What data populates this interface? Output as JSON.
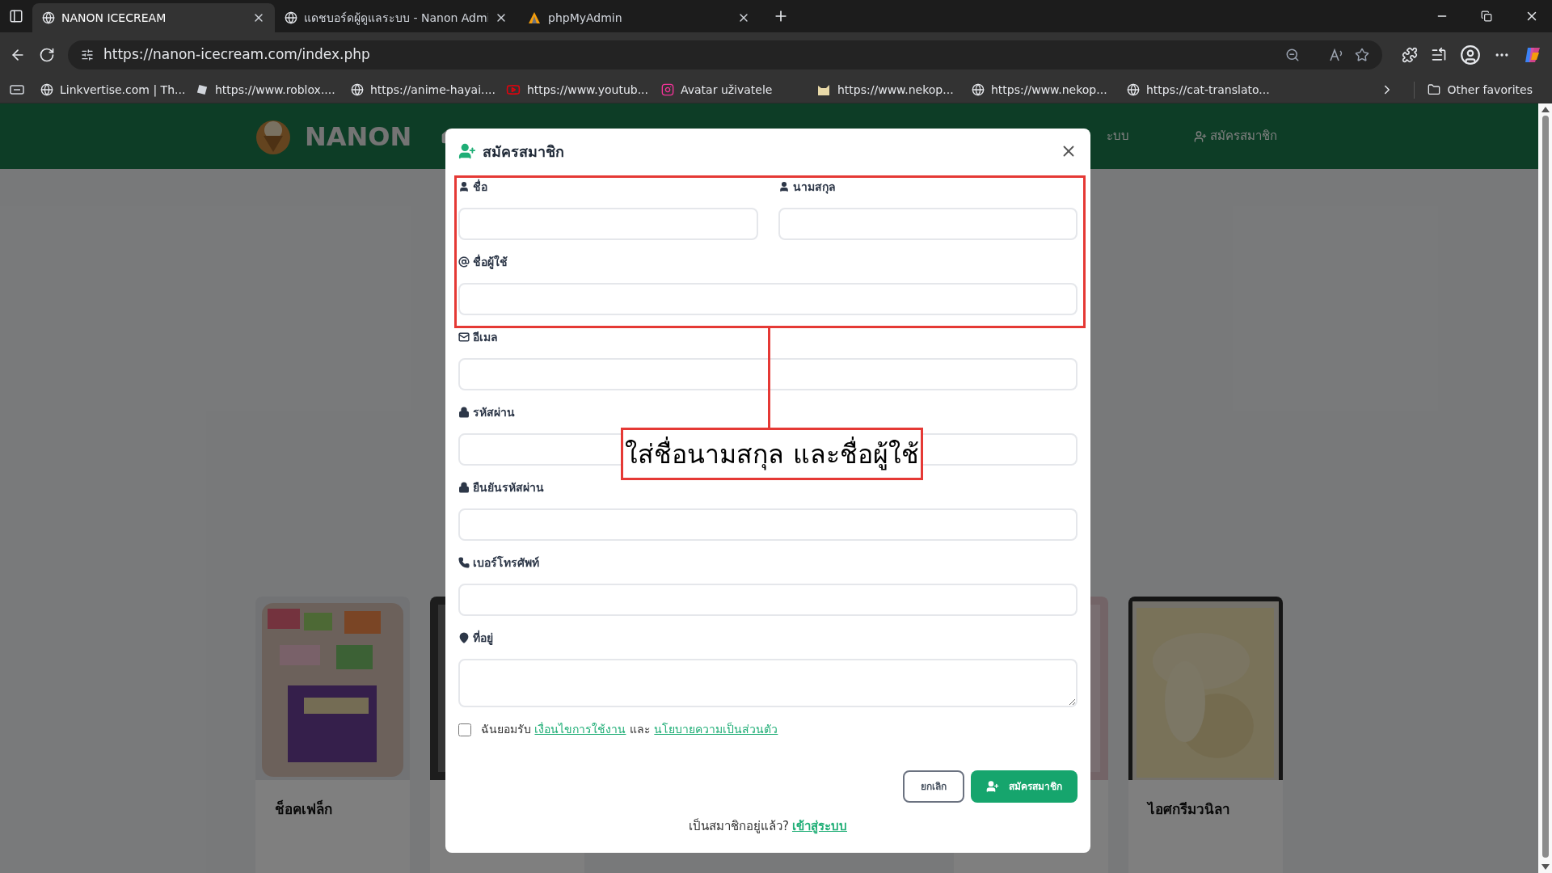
{
  "browser": {
    "tabs": [
      {
        "title": "NANON ICECREAM",
        "selected": true
      },
      {
        "title": "แดชบอร์ดผู้ดูแลระบบ - Nanon Admi",
        "selected": false
      },
      {
        "title": "phpMyAdmin",
        "selected": false
      }
    ],
    "url": "https://nanon-icecream.com/index.php",
    "bookmarks": [
      {
        "label": "Linkvertise.com | Th..."
      },
      {
        "label": "https://www.roblox...."
      },
      {
        "label": "https://anime-hayai...."
      },
      {
        "label": "https://www.youtub..."
      },
      {
        "label": "Avatar uživatele"
      },
      {
        "label": "https://www.nekop..."
      },
      {
        "label": "https://www.nekop..."
      },
      {
        "label": "https://cat-translato..."
      }
    ],
    "other_favorites": "Other favorites"
  },
  "site": {
    "brand": "NANON",
    "nav": [
      {
        "label": "ะบบ"
      },
      {
        "label": "สมัครสมาชิก"
      }
    ],
    "products": [
      {
        "kind": "picture",
        "name": "ช็อคเฟล็ก"
      },
      {
        "kind": "picture"
      },
      {
        "kind": "picture"
      },
      {
        "kind": "picture",
        "name": "ไอศกรีมวนิลา"
      }
    ]
  },
  "modal": {
    "title": "สมัครสมาชิก",
    "fields": [
      {
        "label": "ชื่อ",
        "kind": "input"
      },
      {
        "label": "นามสกุล",
        "kind": "input"
      },
      {
        "label": "ชื่อผู้ใช้",
        "kind": "input"
      },
      {
        "label": "อีเมล",
        "kind": "input"
      },
      {
        "label": "รหัสผ่าน",
        "kind": "input"
      },
      {
        "label": "ยืนยันรหัสผ่าน",
        "kind": "input"
      },
      {
        "label": "เบอร์โทรศัพท์",
        "kind": "input"
      },
      {
        "label": "ที่อยู่",
        "kind": "textarea"
      }
    ],
    "terms": {
      "checked": false,
      "before": "ฉันยอมรับ",
      "link_terms": "เงื่อนไขการใช้งาน",
      "middle": "และ",
      "link_privacy": "นโยบายความเป็นส่วนตัว"
    },
    "buttons": {
      "cancel": "ยกเลิก",
      "submit": "สมัครสมาชิก"
    },
    "footer": {
      "text": "เป็นสมาชิกอยู่แล้ว?",
      "link": "เข้าสู่ระบบ"
    }
  },
  "annotation": {
    "text": "ใส่ชื่อนามสกุล และชื่อผู้ใช้"
  }
}
